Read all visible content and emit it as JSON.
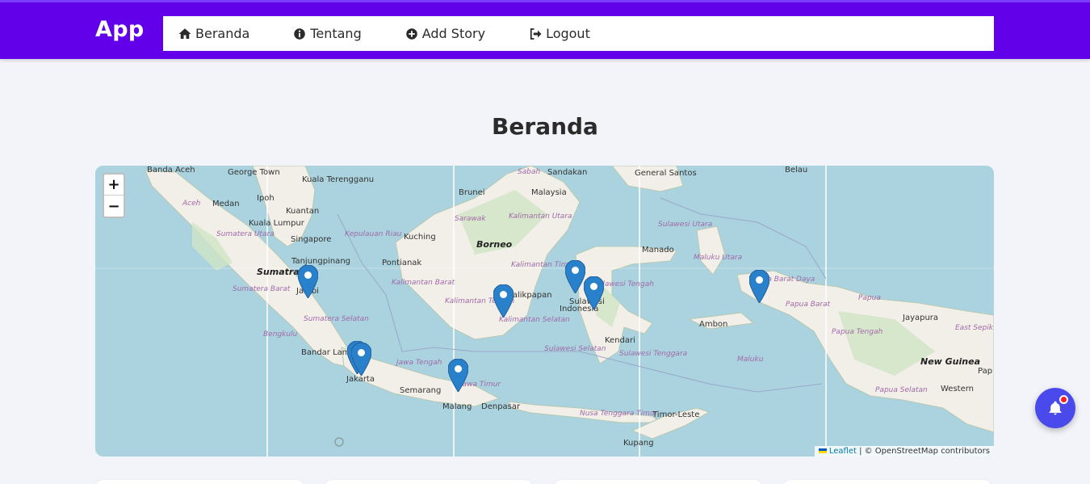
{
  "app": {
    "brand": "App"
  },
  "nav": {
    "items": [
      {
        "label": "Beranda",
        "icon": "home-icon"
      },
      {
        "label": "Tentang",
        "icon": "info-icon"
      },
      {
        "label": "Add Story",
        "icon": "plus-circle-icon"
      },
      {
        "label": "Logout",
        "icon": "logout-icon"
      }
    ]
  },
  "page": {
    "title": "Beranda"
  },
  "map": {
    "zoom_in": "+",
    "zoom_out": "−",
    "attribution_link": "Leaflet",
    "attribution_text": " | © OpenStreetMap contributors",
    "labels": {
      "banda_aceh": "Banda Aceh",
      "george_town": "George Town",
      "kuala_terengganu": "Kuala Terengganu",
      "sabah": "Sabah",
      "sandakan": "Sandakan",
      "general_santos": "General Santos",
      "belau": "Belau",
      "medan": "Medan",
      "ipoh": "Ipoh",
      "brunei": "Brunei",
      "malaysia": "Malaysia",
      "aceh": "Aceh",
      "sumatera_utara": "Sumatera Utara",
      "kuala_lumpur": "Kuala Lumpur",
      "kuantan": "Kuantan",
      "sarawak": "Sarawak",
      "kalimantan_utara": "Kalimantan Utara",
      "singapore": "Singapore",
      "kepulauan_riau": "Kepulauan Riau",
      "kuching": "Kuching",
      "borneo": "Borneo",
      "sulawesi_utara": "Sulawesi Utara",
      "manado": "Manado",
      "maluku_utara": "Maluku Utara",
      "tanjungpinang": "Tanjungpinang",
      "pontianak": "Pontianak",
      "sumatra": "Sumatra",
      "kalimantan_timur": "Kalimantan Timur",
      "sumatera_barat": "Sumatera Barat",
      "jambi": "Jambi",
      "kalimantan_barat": "Kalimantan Barat",
      "balikpapan": "Balikpapan",
      "sulawesi_tengah": "Sulawesi Tengah",
      "papua_barat_daya": "Papua Barat Daya",
      "sulawesi": "Sulawesi",
      "indonesia": "Indonesia",
      "papua": "Papua",
      "papua_barat": "Papua Barat",
      "kalimantan_tengah": "Kalimantan Tengah",
      "jayapura": "Jayapura",
      "sumatera_selatan": "Sumatera Selatan",
      "kalimantan_selatan": "Kalimantan Selatan",
      "ambon": "Ambon",
      "papua_tengah": "Papua Tengah",
      "east_sepik": "East Sepik",
      "bengkulu": "Bengkulu",
      "kendari": "Kendari",
      "sulawesi_selatan": "Sulawesi Selatan",
      "bandar_lampung": "Bandar Lampung",
      "sulawesi_tenggara": "Sulawesi Tenggara",
      "maluku": "Maluku",
      "new_guinea": "New Guinea",
      "pap": "Pap",
      "jawa_tengah": "Jawa Tengah",
      "jakarta": "Jakarta",
      "semarang": "Semarang",
      "jawa_timur": "Jawa Timur",
      "papua_selatan": "Papua Selatan",
      "western": "Western",
      "malang": "Malang",
      "denpasar": "Denpasar",
      "nusa_tenggara_timur": "Nusa Tenggara Timur",
      "timor_leste": "Timor-Leste",
      "kupang": "Kupang"
    }
  },
  "colors": {
    "brand": "#6200ea",
    "marker": "#2a81cb",
    "bell": "#4a49ec",
    "badge": "#ff1e1e",
    "sea": "#aad3df",
    "land": "#f2efe9"
  }
}
